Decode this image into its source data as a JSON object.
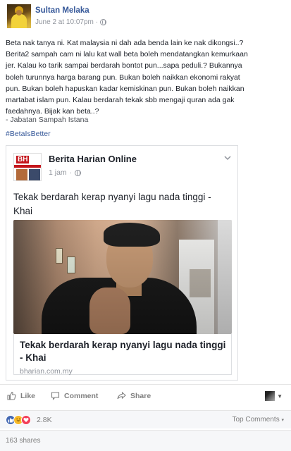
{
  "post": {
    "author": "Sultan Melaka",
    "timestamp": "June 2 at 10:07pm",
    "separator": "·",
    "body": [
      "Beta nak tanya ni. Kat malaysia ni dah ada benda lain ke nak dikongsi..?",
      "Berita2 sampah cam ni lalu kat wall beta boleh mendatangkan kemurkaan",
      "jer. Kalau ko tarik sampai berdarah bontot pun...sapa peduli.? Bukannya",
      "boleh turunnya harga barang pun. Bukan boleh naikkan ekonomi rakyat",
      "pun. Bukan boleh hapuskan kadar kemiskinan pun. Bukan boleh naikkan",
      "martabat islam pun. Kalau berdarah tekak sbb mengaji quran ada gak",
      "faedahnya. Bijak kan beta..?"
    ],
    "signature": "- Jabatan Sampah Istana",
    "hashtag": "#BetaIsBetter"
  },
  "shared": {
    "page_name": "Berita Harian Online",
    "logo_text": "BH",
    "time": "1 jam",
    "separator": "·",
    "title": "Tekak berdarah kerap nyanyi lagu nada tinggi - Khai",
    "link_title": "Tekak berdarah kerap nyanyi lagu nada tinggi - Khai",
    "domain": "bharian.com.my"
  },
  "actions": {
    "like": "Like",
    "comment": "Comment",
    "share": "Share"
  },
  "reactions": {
    "count": "2.8K",
    "types": [
      "like",
      "haha",
      "love"
    ],
    "sort_label": "Top Comments",
    "shares_label": "163 shares"
  },
  "colors": {
    "link_blue": "#365899",
    "like_blue": "#4267b2",
    "haha_yellow": "#f7b928",
    "love_red": "#f33e58"
  }
}
